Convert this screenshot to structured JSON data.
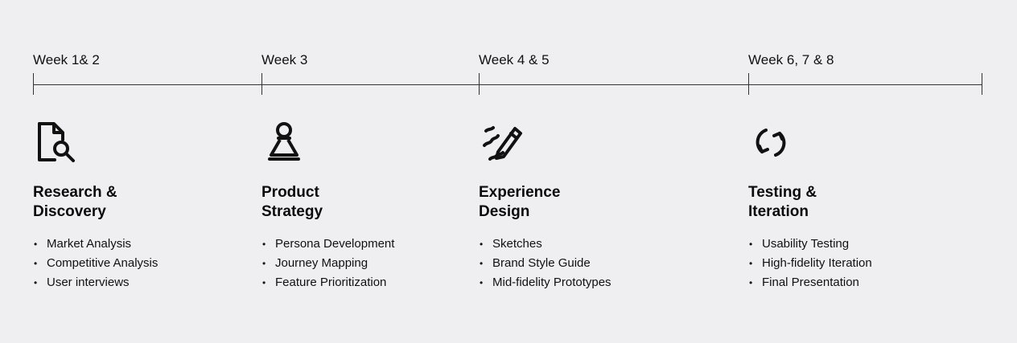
{
  "timeline": {
    "weeks": [
      "Week 1& 2",
      "Week 3",
      "Week 4 & 5",
      "Week 6, 7 & 8"
    ]
  },
  "phases": [
    {
      "icon": "document-search-icon",
      "title": [
        "Research &",
        "Discovery"
      ],
      "items": [
        "Market Analysis",
        "Competitive Analysis",
        "User interviews"
      ]
    },
    {
      "icon": "chess-pawn-icon",
      "title": [
        "Product",
        "Strategy"
      ],
      "items": [
        "Persona Development",
        "Journey Mapping",
        "Feature Prioritization"
      ]
    },
    {
      "icon": "pencil-sketch-icon",
      "title": [
        "Experience",
        "Design"
      ],
      "items": [
        "Sketches",
        "Brand Style Guide",
        "Mid-fidelity Prototypes"
      ]
    },
    {
      "icon": "refresh-cycle-icon",
      "title": [
        "Testing &",
        "Iteration"
      ],
      "items": [
        "Usability Testing",
        "High-fidelity Iteration",
        "Final Presentation"
      ]
    }
  ],
  "style": {
    "background": "#efeff1",
    "text": "#111111",
    "line": "#333333"
  }
}
